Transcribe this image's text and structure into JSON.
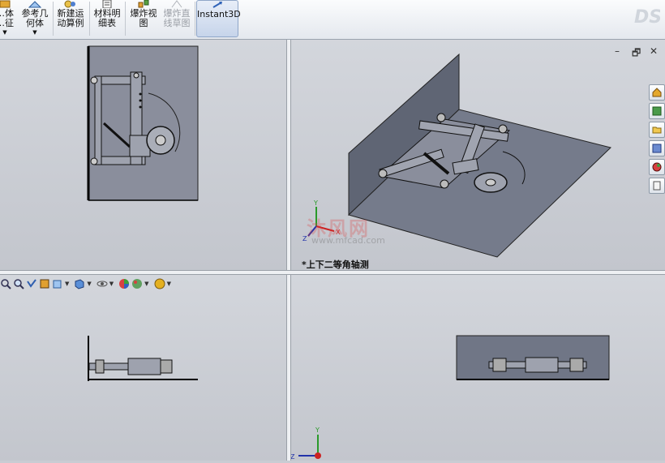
{
  "toolbar": {
    "items": [
      {
        "label": "…体\n…征",
        "has_dropdown": true
      },
      {
        "label": "参考几\n何体",
        "has_dropdown": true
      },
      {
        "label": "新建运\n动算例"
      },
      {
        "label": "材料明\n细表"
      },
      {
        "label": "爆炸视\n图"
      },
      {
        "label": "爆炸直\n线草图",
        "disabled": true
      },
      {
        "label": "Instant3D",
        "active": true
      }
    ]
  },
  "window_controls": {
    "minimize": "–",
    "restore": "🗗",
    "close": "✕"
  },
  "views": {
    "iso_label": "*上下二等角轴测"
  },
  "triad": {
    "x": "X",
    "y": "Y",
    "z": "Z"
  },
  "watermark": {
    "text": "沐风网",
    "url": "www.mfcad.com"
  },
  "task_pane": [
    "home-icon",
    "resources-icon",
    "folder-icon",
    "view-palette-icon",
    "appearance-icon",
    "custom-properties-icon"
  ],
  "hud_icons": [
    "zoom-to-fit-icon",
    "zoom-area-icon",
    "previous-view-icon",
    "section-view-icon",
    "view-orientation-icon",
    "display-style-icon",
    "hide-show-icon",
    "edit-appearance-icon",
    "apply-scene-icon",
    "display-settings-icon"
  ],
  "colors": {
    "viewport_bg": "#c9ccd3",
    "part_fill": "#7d8190",
    "sheet_fill": "#707686",
    "accent": "#3355aa"
  }
}
